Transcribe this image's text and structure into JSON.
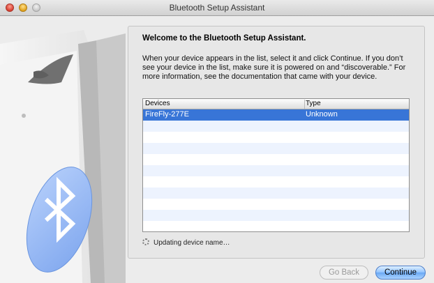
{
  "window": {
    "title": "Bluetooth Setup Assistant"
  },
  "content": {
    "heading": "Welcome to the Bluetooth Setup Assistant.",
    "description": "When your device appears in the list, select it and click Continue. If you don’t see your device in the list, make sure it is powered on and “discoverable.” For more information, see the documentation that came with your device."
  },
  "table": {
    "columns": [
      "Devices",
      "Type"
    ],
    "rows": [
      {
        "device": "FireFly-277E",
        "type": "Unknown",
        "selected": true
      }
    ],
    "empty_row_count": 10
  },
  "status": {
    "text": "Updating device name…"
  },
  "buttons": {
    "back": "Go Back",
    "continue": "Continue",
    "back_enabled": false
  },
  "colors": {
    "selection": "#3875d7",
    "bluetooth": "#8fb6f2"
  },
  "icons": [
    "bluetooth-icon",
    "tuxedo-illustration",
    "spinner-icon"
  ]
}
